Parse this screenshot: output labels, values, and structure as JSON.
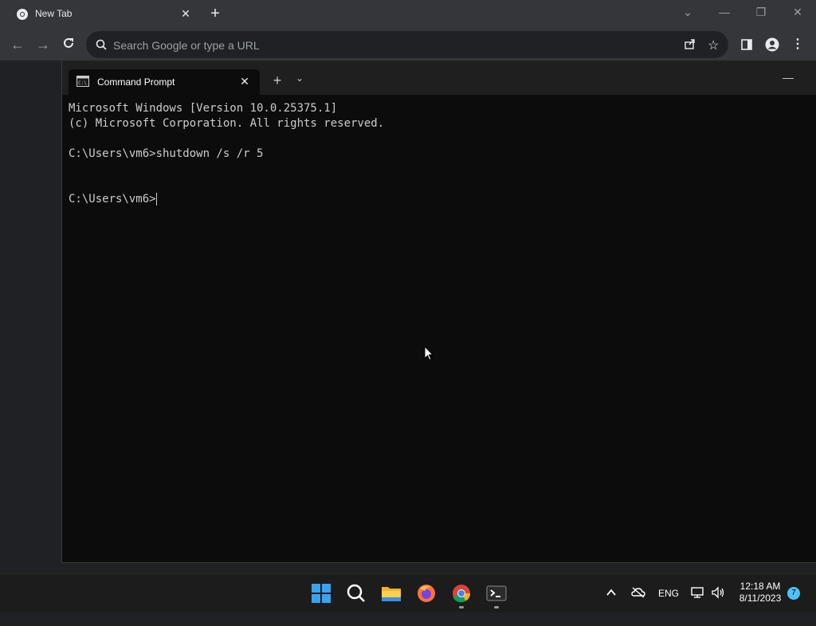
{
  "browser": {
    "tab_title": "New Tab",
    "omnibox_placeholder": "Search Google or type a URL"
  },
  "terminal": {
    "tab_title": "Command Prompt",
    "lines": [
      "Microsoft Windows [Version 10.0.25375.1]",
      "(c) Microsoft Corporation. All rights reserved.",
      "",
      "C:\\Users\\vm6>shutdown /s /r 5",
      "",
      "",
      "C:\\Users\\vm6>"
    ],
    "background": "#0c0c0c",
    "foreground": "#cccccc"
  },
  "taskbar": {
    "apps": [
      "windows-start-icon",
      "search-icon",
      "file-explorer-icon",
      "firefox-icon",
      "chrome-icon",
      "terminal-icon"
    ],
    "language": "ENG",
    "time": "12:18 AM",
    "date": "8/11/2023",
    "notification_count": "7"
  },
  "colors": {
    "chrome_frame": "#35363a",
    "accent_blue": "#4cc2ff"
  }
}
